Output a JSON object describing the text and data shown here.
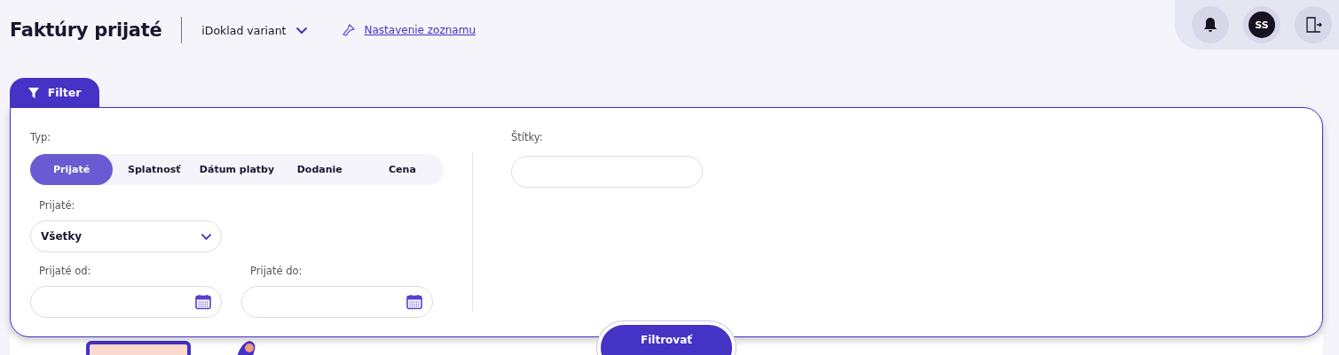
{
  "header": {
    "title": "Faktúry prijaté",
    "variant": "iDoklad variant",
    "settings_link": "Nastavenie zoznamu"
  },
  "user_actions": {
    "avatar_initials": "SS"
  },
  "filter": {
    "tab_label": "Filter",
    "type_label": "Typ:",
    "type_tabs": [
      {
        "label": "Prijaté",
        "selected": true
      },
      {
        "label": "Splatnosť",
        "selected": false
      },
      {
        "label": "Dátum platby",
        "selected": false
      },
      {
        "label": "Dodanie",
        "selected": false
      },
      {
        "label": "Cena",
        "selected": false
      }
    ],
    "received_label": "Prijaté:",
    "received_value": "Všetky",
    "from_label": "Prijaté od:",
    "to_label": "Prijaté do:",
    "tags_label": "Štítky:",
    "submit": "Filtrovať"
  }
}
